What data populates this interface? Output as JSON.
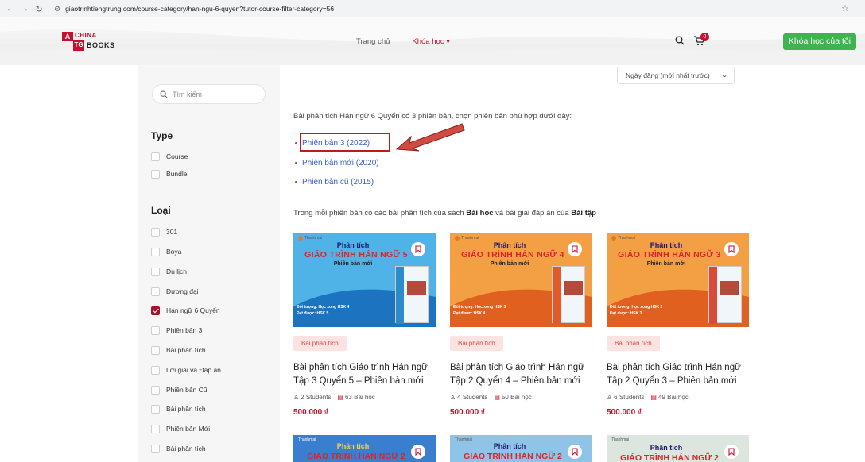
{
  "browser": {
    "url": "giaotrinhtiengtrung.com/course-category/han-ngu-6-quyen?tutor-course-filter-category=56"
  },
  "header": {
    "logo_line1": "CHINA",
    "logo_line2": "BOOKS",
    "logo_mark1": "A",
    "logo_mark2": "TG",
    "nav": [
      {
        "label": "Trang chủ"
      },
      {
        "label": "Khóa học ▾"
      }
    ],
    "cart_count": "0",
    "my_courses": "Khóa học của tôi"
  },
  "sidebar": {
    "search_placeholder": "Tìm kiếm",
    "type_title": "Type",
    "type_items": [
      "Course",
      "Bundle"
    ],
    "category_title": "Loại",
    "category_items": [
      "301",
      "Boya",
      "Du lịch",
      "Đương đại",
      "Hán ngữ 6 Quyển",
      "Phiên bản 3",
      "Bài phân tích",
      "Lời giải và Đáp án",
      "Phiên bản Cũ",
      "Bài phân tích",
      "Phiên bản Mới",
      "Bài phân tích"
    ],
    "checked_item": "Hán ngữ 6 Quyển"
  },
  "main": {
    "sort_label": "Ngày đăng (mới nhất trước)",
    "intro": "Bài phân tích Hán ngữ 6 Quyển có 3 phiên bản, chọn phiên bản phù hợp dưới đây:",
    "versions": [
      "Phiên bản 3 (2022)",
      "Phiên bản mới (2020)",
      "Phiên bản cũ (2015)"
    ],
    "desc_part1": "Trong mỗi phiên bản có các bài phân tích của sách ",
    "desc_bold1": "Bài học",
    "desc_part2": " và bài giải đáp án của ",
    "desc_bold2": "Bài tập"
  },
  "cards": [
    {
      "thumb_t1": "Phân tích",
      "thumb_t2": "GIÁO TRÌNH HÁN NGỮ 5",
      "thumb_t3": "Phiên bản mới",
      "thumb_info1": "Đối tượng: Học xong HSK 4",
      "thumb_info2": "Đạt được: HSK 5",
      "brand": "Thanhmai",
      "tag": "Bài phân tích",
      "title": "Bài phân tích Giáo trình Hán ngữ Tập 3 Quyển 5 – Phiên bản mới",
      "students": "2 Students",
      "lessons": "63 Bài học",
      "price": "500.000 ₫",
      "bg": "#4fb3e8",
      "wave": "#1c73c0"
    },
    {
      "thumb_t1": "Phân tích",
      "thumb_t2": "GIÁO TRÌNH HÁN NGỮ 4",
      "thumb_t3": "Phiên bản mới",
      "thumb_info1": "Đối tượng: Học xong HSK 3",
      "thumb_info2": "Đạt được: HSK 4",
      "brand": "Thanhmai",
      "tag": "Bài phân tích",
      "title": "Bài phân tích Giáo trình Hán ngữ Tập 2 Quyển 4 – Phiên bản mới",
      "students": "4 Students",
      "lessons": "50 Bài học",
      "price": "500.000 ₫",
      "bg": "#f3a045",
      "wave": "#e0611f"
    },
    {
      "thumb_t1": "Phân tích",
      "thumb_t2": "GIÁO TRÌNH HÁN NGỮ 3",
      "thumb_t3": "Phiên bản mới",
      "thumb_info1": "Đối tượng: Học xong HSK 2",
      "thumb_info2": "Đạt được: HSK 3",
      "brand": "Thanhmai",
      "tag": "Bài phân tích",
      "title": "Bài phân tích Giáo trình Hán ngữ Tập 2 Quyển 3 – Phiên bản mới",
      "students": "6 Students",
      "lessons": "49 Bài học",
      "price": "500.000 ₫",
      "bg": "#f3a045",
      "wave": "#e0611f"
    }
  ],
  "cards_row2": [
    {
      "t1": "Phân tích",
      "t2": "GIÁO TRÌNH HÁN NGỮ 2",
      "brand": "Thanhmai",
      "bg": "#3a7fcf"
    },
    {
      "t1": "Phân tích",
      "t2": "GIÁO TRÌNH HÁN NGỮ 2",
      "brand": "Thanhmai",
      "bg": "#8fc4e8"
    },
    {
      "t1": "Phân tích",
      "t2": "GIÁO TRÌNH HÁN NGỮ 2",
      "brand": "Thanhmai",
      "bg": "#dce6df"
    }
  ],
  "colors": {
    "accent_red": "#c8102e",
    "link_blue": "#3a5fc5",
    "button_green": "#3eb34f"
  }
}
